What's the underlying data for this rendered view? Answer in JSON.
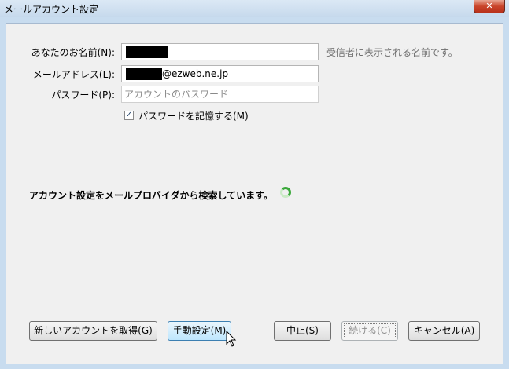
{
  "window": {
    "title": "メールアカウント設定",
    "close_glyph": "✕"
  },
  "form": {
    "name_label": "あなたのお名前(N):",
    "name_value": "",
    "name_hint": "受信者に表示される名前です。",
    "email_label": "メールアドレス(L):",
    "email_domain": "@ezweb.ne.jp",
    "password_label": "パスワード(P):",
    "password_placeholder": "アカウントのパスワード",
    "remember_label": "パスワードを記憶する(M)",
    "remember_checked": true
  },
  "status": {
    "message": "アカウント設定をメールプロバイダから検索しています。"
  },
  "buttons": {
    "new_account": "新しいアカウントを取得(G)",
    "manual": "手動設定(M)",
    "stop": "中止(S)",
    "continue": "続ける(C)",
    "cancel": "キャンセル(A)"
  },
  "colors": {
    "spinner": "#3aa83a",
    "hover_button": "#bee6fd"
  }
}
